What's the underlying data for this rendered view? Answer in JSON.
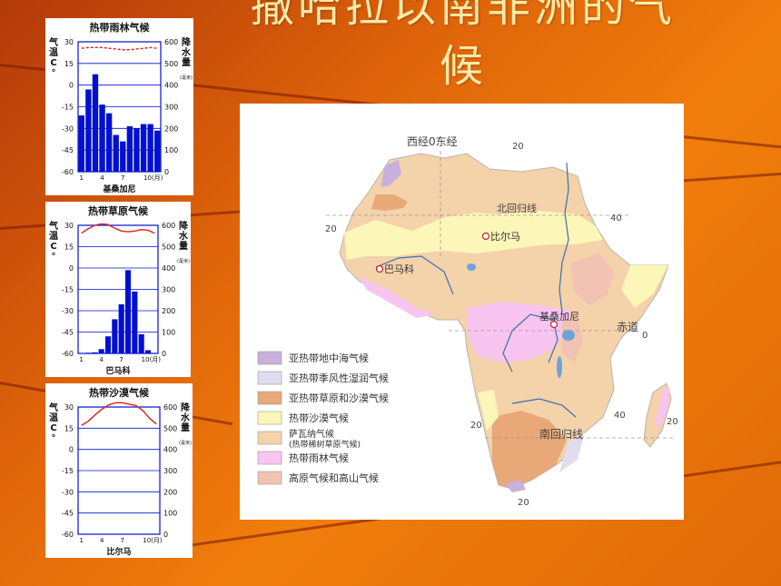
{
  "slide": {
    "title_line1": "撒哈拉以南非洲的气",
    "title_line2": "候"
  },
  "chart_data": [
    {
      "type": "bar",
      "title": "热带雨林气候",
      "station": "基桑加尼",
      "y_left_label": "气温 C°",
      "y_right_label": "降水量",
      "y_right_unit": "(毫米)",
      "temp_ticks": [
        "30",
        "15",
        "0",
        "-15",
        "-30",
        "-45",
        "-60"
      ],
      "precip_ticks": [
        "600",
        "500",
        "400",
        "300",
        "200",
        "100",
        "0"
      ],
      "x_ticks": [
        "1",
        "4",
        "7",
        "10(月)"
      ],
      "categories": [
        "1",
        "2",
        "3",
        "4",
        "5",
        "6",
        "7",
        "8",
        "9",
        "10",
        "11",
        "12"
      ],
      "precip": [
        260,
        380,
        450,
        310,
        270,
        170,
        140,
        210,
        200,
        220,
        220,
        190
      ],
      "temp": [
        25.5,
        26,
        26,
        26,
        25.5,
        25,
        24.5,
        24.5,
        25,
        25.5,
        26,
        25.5
      ],
      "precip_range": [
        0,
        600
      ],
      "temp_range": [
        -60,
        30
      ]
    },
    {
      "type": "bar",
      "title": "热带草原气候",
      "station": "巴马科",
      "y_left_label": "气温 C°",
      "y_right_label": "降水量",
      "y_right_unit": "(毫米)",
      "temp_ticks": [
        "30",
        "15",
        "0",
        "-15",
        "-30",
        "-45",
        "-60"
      ],
      "precip_ticks": [
        "600",
        "500",
        "400",
        "300",
        "200",
        "100",
        "0"
      ],
      "x_ticks": [
        "1",
        "4",
        "7",
        "10(月)"
      ],
      "categories": [
        "1",
        "2",
        "3",
        "4",
        "5",
        "6",
        "7",
        "8",
        "9",
        "10",
        "11",
        "12"
      ],
      "precip": [
        2,
        3,
        5,
        20,
        80,
        160,
        230,
        390,
        290,
        90,
        15,
        2
      ],
      "temp": [
        24.5,
        27.5,
        30,
        31,
        30.5,
        28,
        26,
        25.5,
        26,
        27,
        26.5,
        24.5
      ],
      "precip_range": [
        0,
        600
      ],
      "temp_range": [
        -60,
        30
      ]
    },
    {
      "type": "bar",
      "title": "热带沙漠气候",
      "station": "比尔马",
      "y_left_label": "气温 C°",
      "y_right_label": "降水量",
      "y_right_unit": "(毫米)",
      "temp_ticks": [
        "30",
        "15",
        "0",
        "-15",
        "-30",
        "-45",
        "-60"
      ],
      "precip_ticks": [
        "600",
        "500",
        "400",
        "300",
        "200",
        "100",
        "0"
      ],
      "x_ticks": [
        "1",
        "4",
        "7",
        "10(月)"
      ],
      "categories": [
        "1",
        "2",
        "3",
        "4",
        "5",
        "6",
        "7",
        "8",
        "9",
        "10",
        "11",
        "12"
      ],
      "precip": [
        0,
        0,
        0,
        0,
        0,
        0,
        0,
        0,
        0,
        0,
        0,
        0
      ],
      "temp": [
        17,
        20,
        24.5,
        28.5,
        31.5,
        33,
        33,
        32,
        31,
        27.5,
        22,
        18
      ],
      "precip_range": [
        0,
        600
      ],
      "temp_range": [
        -60,
        30
      ]
    }
  ],
  "map": {
    "coord_labels": {
      "prime": "西经0东经",
      "lon20_top": "20",
      "lat20_left": "20",
      "lon40_top": "40",
      "tropic_north": "北回归线",
      "equator": "赤道",
      "equator_zero": "0",
      "lat20_south_left": "20",
      "lon40_bottom": "40",
      "lat20_right": "20",
      "tropic_south": "南回归线",
      "lon20_bottom": "20"
    },
    "cities": {
      "bilma": "比尔马",
      "bamako": "巴马科",
      "kisangani": "基桑加尼"
    },
    "legend": [
      {
        "label": "亚热带地中海气候",
        "color": "#c8b0dc"
      },
      {
        "label": "亚热带季风性湿润气候",
        "color": "#e2dcef"
      },
      {
        "label": "亚热带草原和沙漠气候",
        "color": "#e8a878"
      },
      {
        "label": "热带沙漠气候",
        "color": "#fcf6b8"
      },
      {
        "label": "萨瓦纳气候",
        "sublabel": "(热带稀树草原气候)",
        "color": "#f4d2aa"
      },
      {
        "label": "热带雨林气候",
        "color": "#f8c4f0"
      },
      {
        "label": "高原气候和高山气候",
        "color": "#f2c2b2"
      }
    ]
  }
}
